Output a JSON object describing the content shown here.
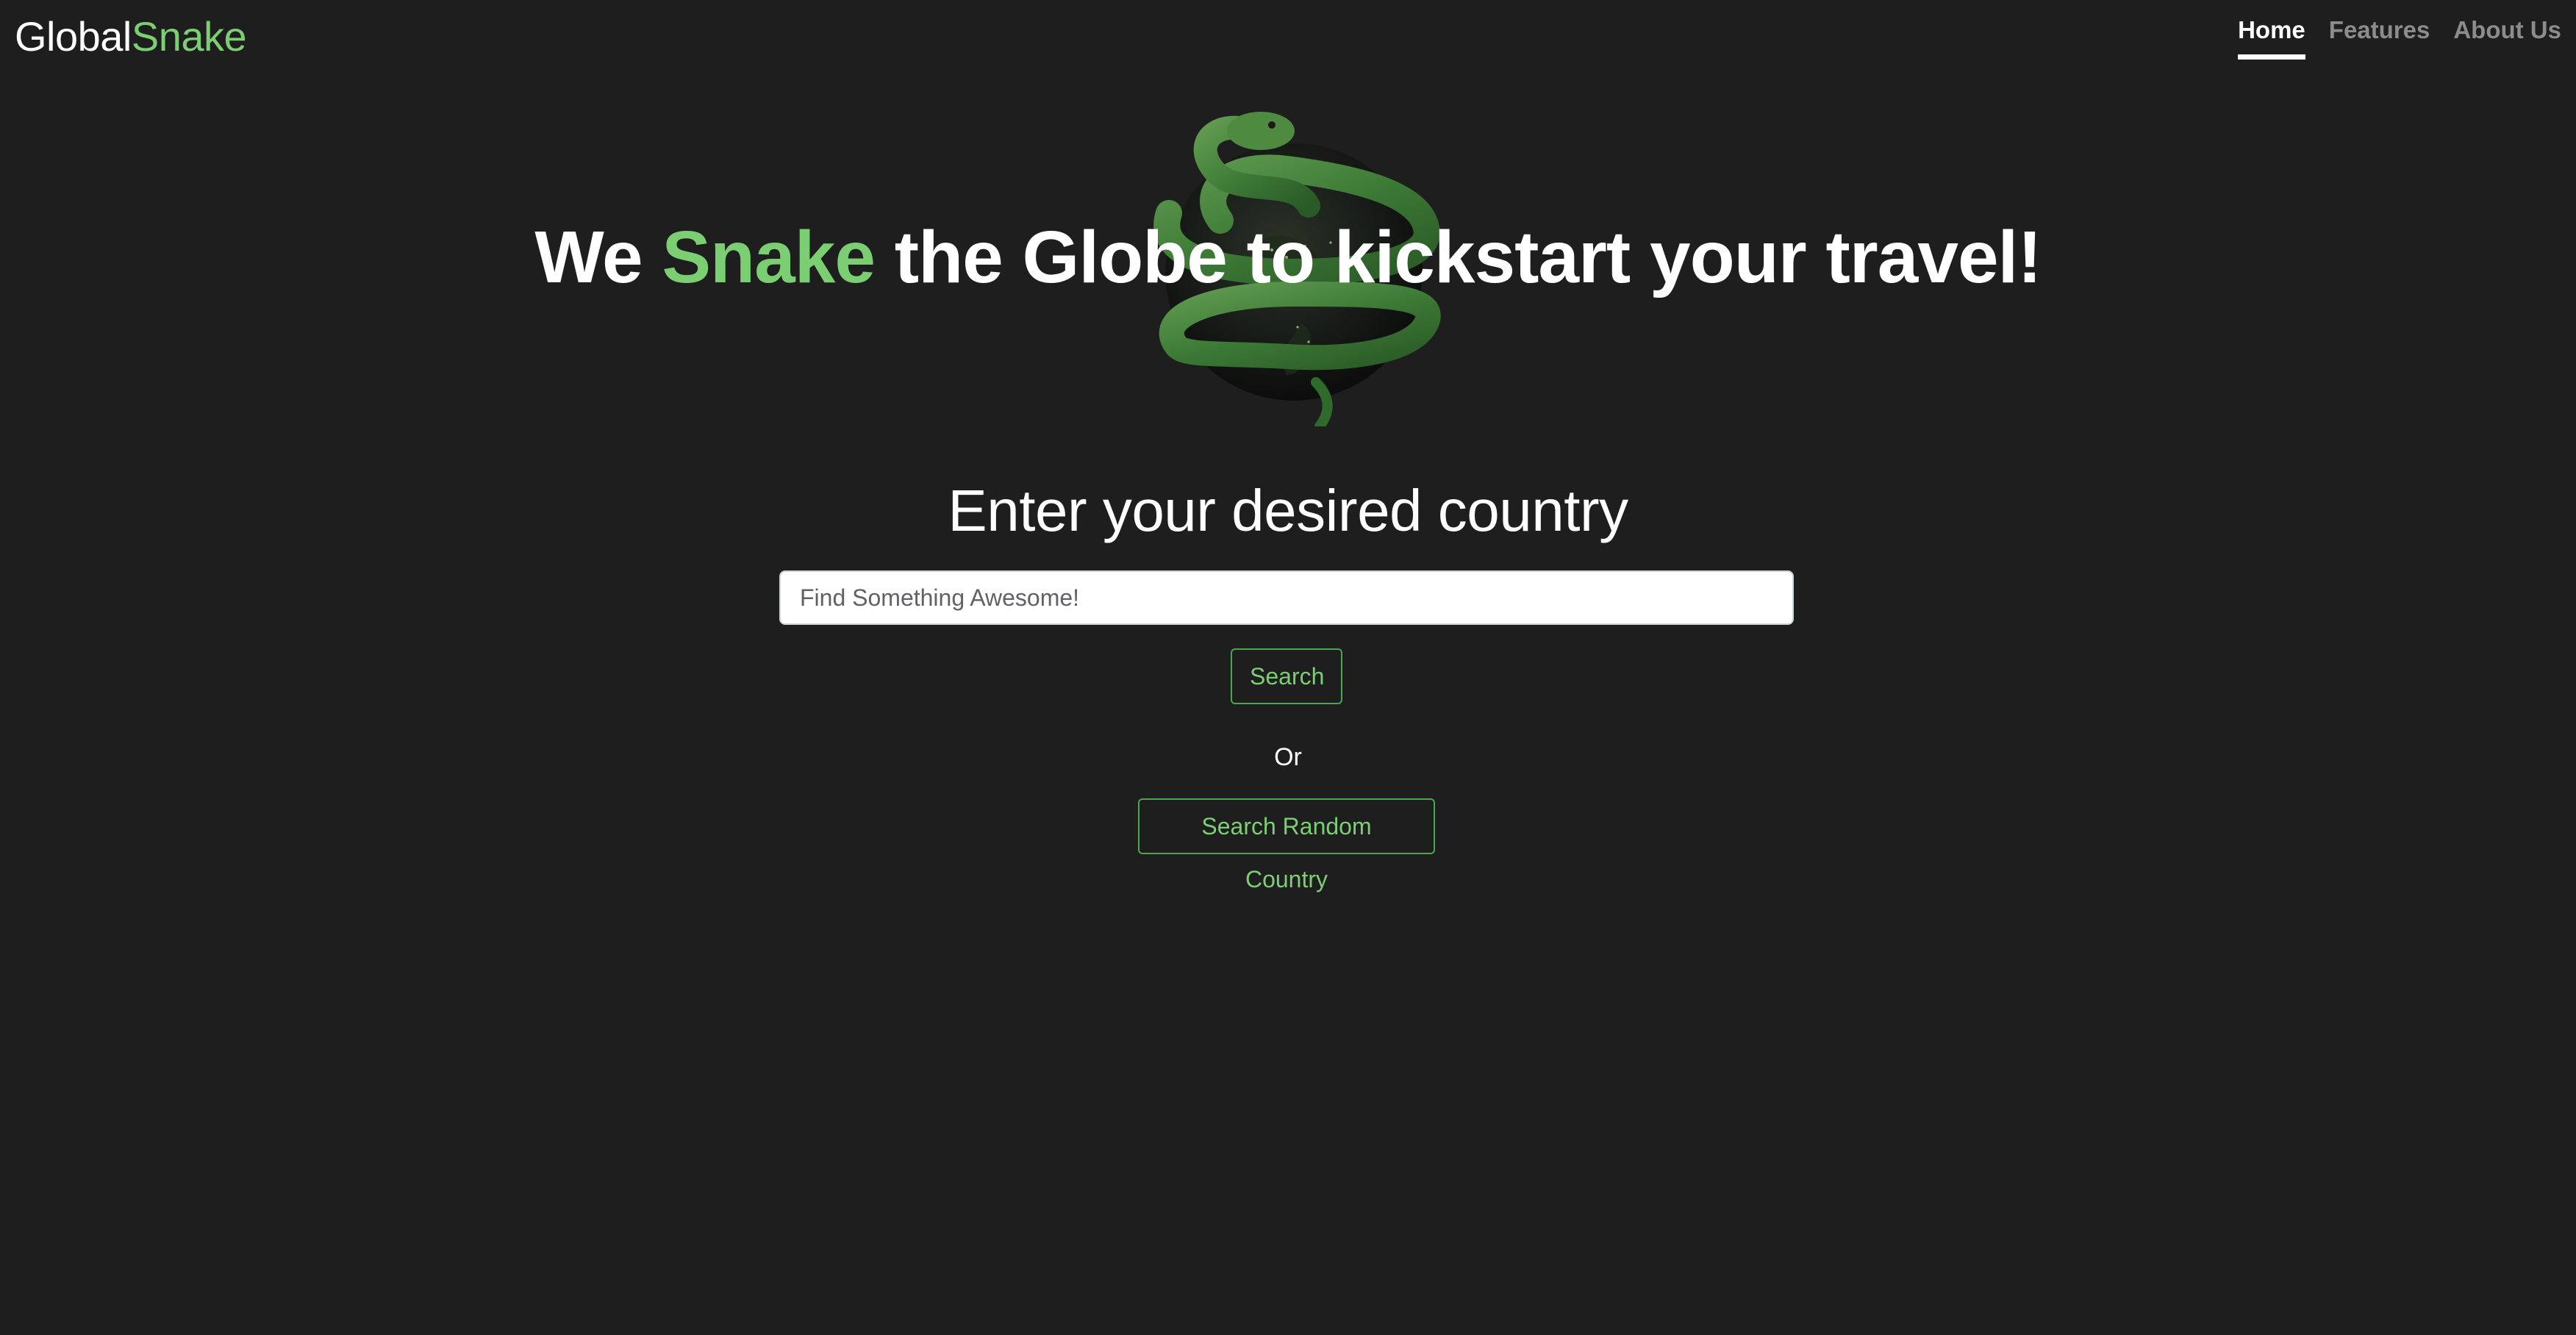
{
  "header": {
    "brand_main": "Global",
    "brand_accent": "Snake",
    "nav": {
      "home": "Home",
      "features": "Features",
      "about": "About Us"
    },
    "active_nav": "Home"
  },
  "hero": {
    "title_prefix": "We ",
    "title_accent": "Snake",
    "title_suffix": " the Globe to kickstart your travel!",
    "image_icon": "snake-wrapped-globe-icon"
  },
  "search": {
    "heading": "Enter your desired country",
    "placeholder": "Find Something Awesome!",
    "value": "",
    "search_label": "Search",
    "or_label": "Or",
    "random_label": "Search Random Country"
  },
  "colors": {
    "background": "#1e1e1e",
    "accent": "#7bcf72",
    "button_border": "#4aa74f",
    "nav_inactive": "#8c8c8c",
    "text": "#ffffff"
  }
}
